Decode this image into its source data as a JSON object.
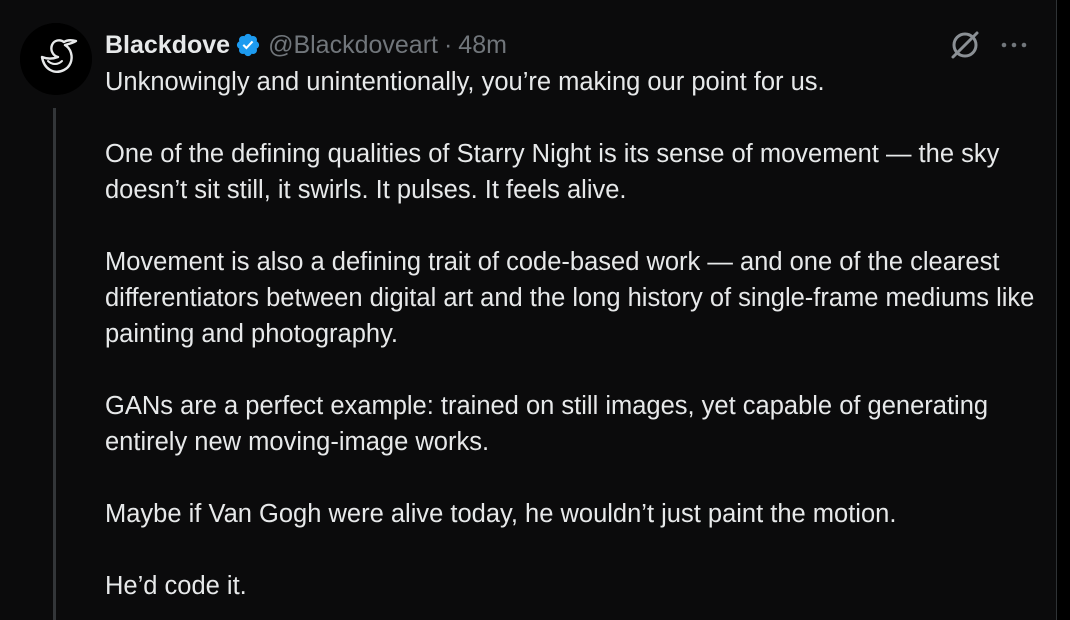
{
  "author": {
    "display_name": "Blackdove",
    "handle": "@Blackdoveart",
    "separator": "·",
    "time": "48m"
  },
  "icons": {
    "avatar": "dove-logo-icon",
    "verified": "verified-badge-icon",
    "grok": "grok-slash-circle-icon",
    "more": "more-dots-icon"
  },
  "colors": {
    "background": "#0b0b0c",
    "text": "#e7e9ea",
    "secondary": "#71767b",
    "verified_blue": "#1d9bf0",
    "thread_line": "#333639"
  },
  "tweet": {
    "paragraphs": [
      "Unknowingly and unintentionally, you’re making our point for us.",
      "One of the defining qualities of Starry Night is its sense of movement — the sky doesn’t sit still, it swirls. It pulses. It feels alive.",
      "Movement is also a defining trait of code-based work — and one of the clearest differentiators between digital art and the long history of single-frame mediums like painting and photography.",
      "GANs are a perfect example: trained on still images, yet capable of generating entirely new moving-image works.",
      "Maybe if Van Gogh were alive today, he wouldn’t just paint the motion.",
      "He’d code it."
    ]
  }
}
